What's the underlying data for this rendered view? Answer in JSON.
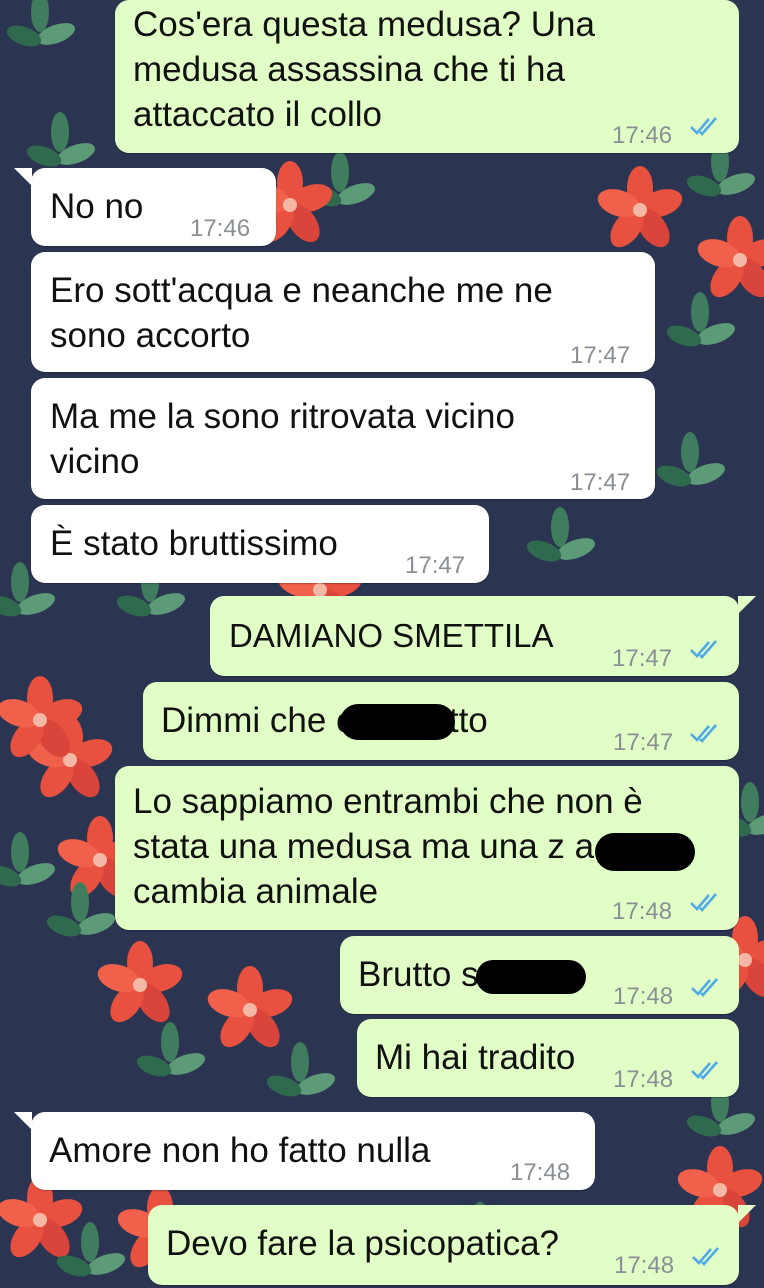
{
  "theme": {
    "wallpaper": "#2b3450",
    "incoming_bubble": "#ffffff",
    "outgoing_bubble": "#e1fec6",
    "read_ticks": "#4fa9e6",
    "flower": "#e8503f",
    "leaf": "#3f7d5e"
  },
  "messages": [
    {
      "direction": "outgoing",
      "text": "Cos'era questa medusa? Una\nmedusa assassina che ti ha\nattaccato il collo",
      "time": "17:46",
      "status_icon": "double-check-read-icon"
    },
    {
      "direction": "incoming",
      "text": "No no",
      "time": "17:46"
    },
    {
      "direction": "incoming",
      "text": "Ero sott'acqua e neanche me ne\nsono accorto",
      "time": "17:47"
    },
    {
      "direction": "incoming",
      "text": "Ma me la sono ritrovata vicino\nvicino",
      "time": "17:47"
    },
    {
      "direction": "incoming",
      "text": "È stato bruttissimo",
      "time": "17:47"
    },
    {
      "direction": "outgoing",
      "text": "DAMIANO SMETTILA",
      "time": "17:47",
      "status_icon": "double-check-read-icon"
    },
    {
      "direction": "outgoing",
      "text": "Dimmi che c         hai fatto",
      "time": "17:47",
      "status_icon": "double-check-read-icon"
    },
    {
      "direction": "outgoing",
      "text": "Lo sappiamo entrambi che non è\nstata una medusa ma una z          a,\ncambia animale",
      "time": "17:48",
      "status_icon": "double-check-read-icon"
    },
    {
      "direction": "outgoing",
      "text": "Brutto st",
      "time": "17:48",
      "status_icon": "double-check-read-icon"
    },
    {
      "direction": "outgoing",
      "text": "Mi hai tradito",
      "time": "17:48",
      "status_icon": "double-check-read-icon"
    },
    {
      "direction": "incoming",
      "text": "Amore non ho fatto nulla",
      "time": "17:48"
    },
    {
      "direction": "outgoing",
      "text": "Devo fare la psicopatica?",
      "time": "17:48",
      "status_icon": "double-check-read-icon"
    }
  ]
}
